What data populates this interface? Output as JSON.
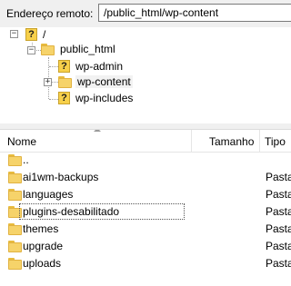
{
  "remote": {
    "label": "Endereço remoto:",
    "path": "/public_html/wp-content"
  },
  "tree": [
    {
      "label": "/",
      "icon": "unknown-folder-icon"
    },
    {
      "label": "public_html",
      "icon": "folder-icon"
    },
    {
      "label": "wp-admin",
      "icon": "unknown-folder-icon"
    },
    {
      "label": "wp-content",
      "icon": "folder-icon",
      "selected": true
    },
    {
      "label": "wp-includes",
      "icon": "unknown-folder-icon"
    }
  ],
  "columns": {
    "name": "Nome",
    "size": "Tamanho",
    "type": "Tipo"
  },
  "files": [
    {
      "name": "..",
      "type": ""
    },
    {
      "name": "ai1wm-backups",
      "type": "Pasta"
    },
    {
      "name": "languages",
      "type": "Pasta"
    },
    {
      "name": "plugins-desabilitado",
      "type": "Pasta",
      "focused": true
    },
    {
      "name": "themes",
      "type": "Pasta"
    },
    {
      "name": "upgrade",
      "type": "Pasta"
    },
    {
      "name": "uploads",
      "type": "Pasta"
    }
  ]
}
